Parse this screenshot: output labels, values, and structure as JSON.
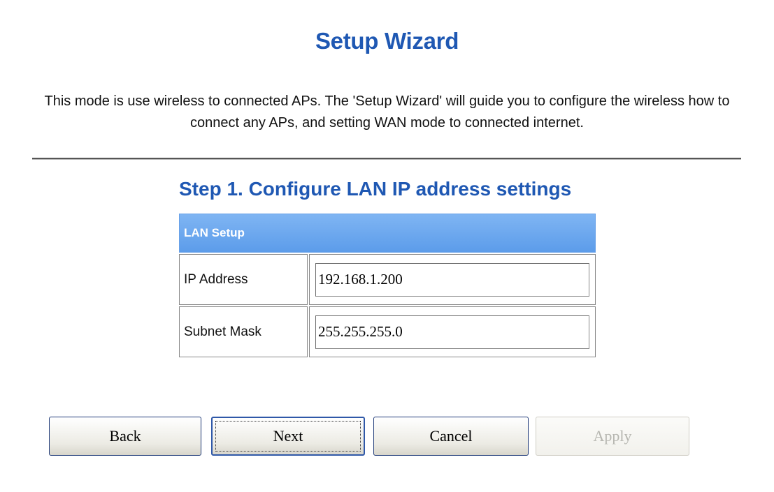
{
  "title": "Setup Wizard",
  "description": "This mode is use wireless to connected APs. The 'Setup Wizard' will guide you to configure the wireless how to connect any APs, and setting WAN mode to connected internet.",
  "step_title": "Step 1. Configure LAN IP address settings",
  "lan_setup": {
    "header": "LAN Setup",
    "rows": [
      {
        "label": "IP Address",
        "value": "192.168.1.200"
      },
      {
        "label": "Subnet Mask",
        "value": "255.255.255.0"
      }
    ]
  },
  "buttons": {
    "back": "Back",
    "next": "Next",
    "cancel": "Cancel",
    "apply": "Apply"
  },
  "colors": {
    "title": "#1f58b3",
    "header_bg": "#6aa2e8",
    "disabled_text": "#b6b6b0"
  }
}
